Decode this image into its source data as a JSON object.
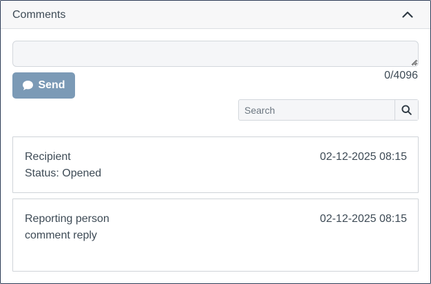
{
  "panel": {
    "title": "Comments",
    "collapse_icon": "chevron-up-icon"
  },
  "composer": {
    "value": "",
    "placeholder": "",
    "counter": "0/4096",
    "send_label": "Send",
    "send_icon": "speech-bubble-icon",
    "send_color": "#7b9ab6"
  },
  "search": {
    "placeholder": "Search",
    "value": "",
    "icon": "search-icon"
  },
  "comments": [
    {
      "author": "Recipient",
      "body": "Status: Opened",
      "timestamp": "02-12-2025 08:15"
    },
    {
      "author": "Reporting person",
      "body": "comment reply",
      "timestamp": "02-12-2025 08:15"
    }
  ]
}
